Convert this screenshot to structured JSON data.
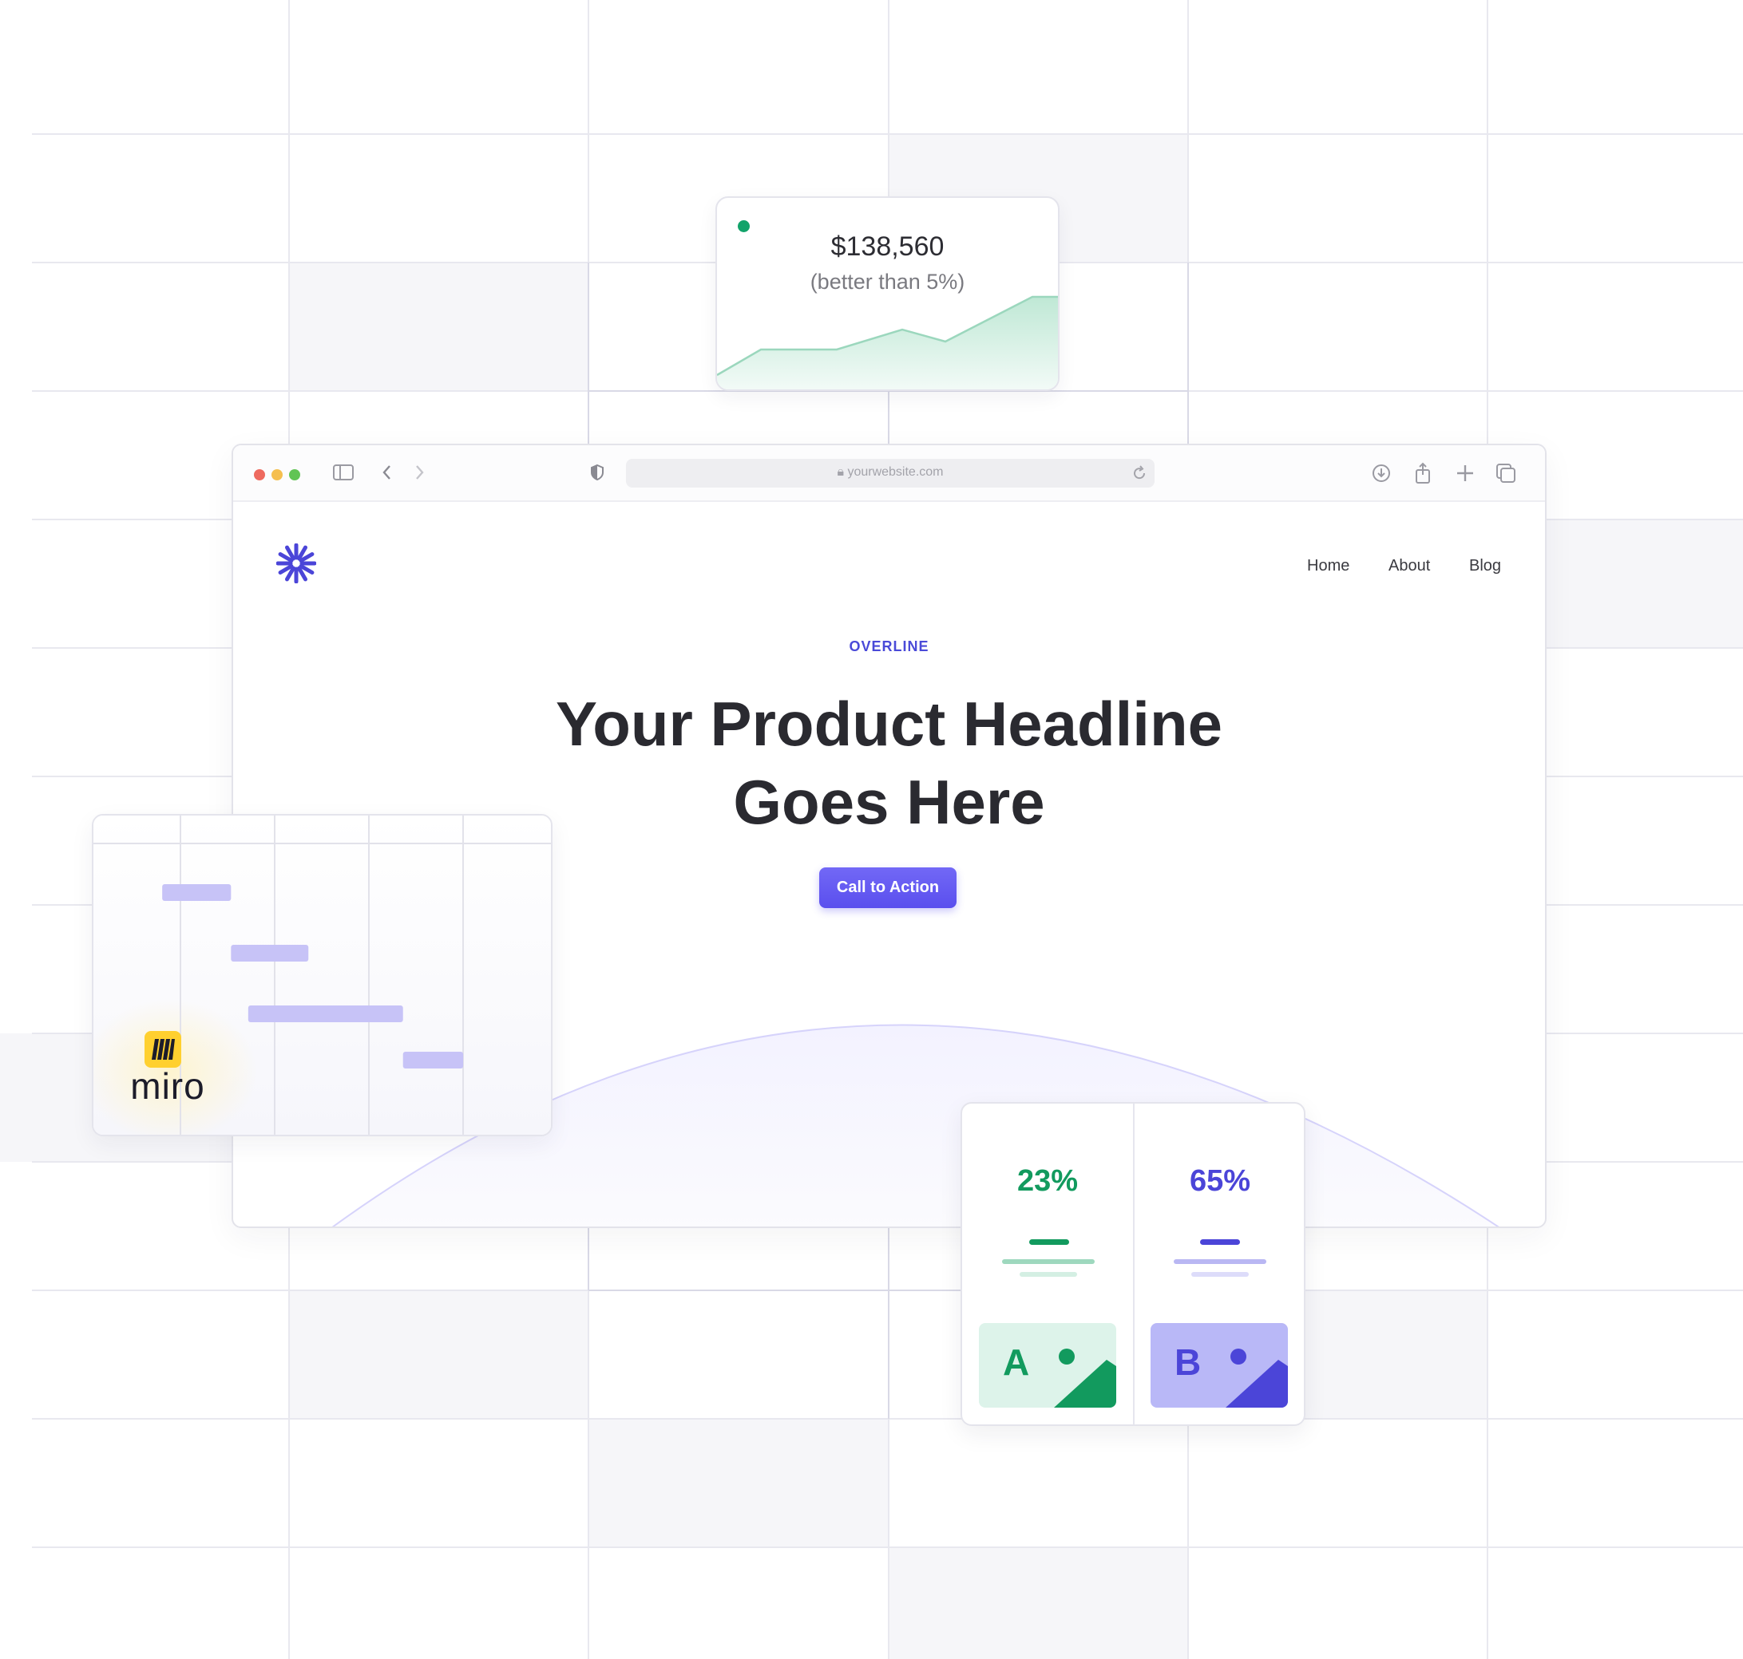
{
  "background": {
    "grid_color": "#e8e8ef",
    "shade_color": "#f6f6f9"
  },
  "revenue_card": {
    "amount": "$138,560",
    "note": "(better than 5%)",
    "status_color": "#12a36a",
    "accent_color": "#9bd7bd"
  },
  "browser": {
    "traffic_lights": [
      "#ee6a5f",
      "#f5bf4f",
      "#61c454"
    ],
    "url": "yourwebsite.com",
    "toolbar_icons": [
      "sidebar-icon",
      "back-icon",
      "forward-icon",
      "shield-icon",
      "reload-icon",
      "download-icon",
      "share-icon",
      "new-tab-icon",
      "tabs-icon"
    ],
    "nav": [
      "Home",
      "About",
      "Blog"
    ],
    "overline": "OVERLINE",
    "headline_line1": "Your Product Headline",
    "headline_line2": "Goes Here",
    "cta_label": "Call to Action",
    "brand_color": "#4b45d8"
  },
  "gantt_card": {
    "bar_color": "#c7c3f7",
    "tasks": [
      {
        "start": 0.8,
        "end": 1.6
      },
      {
        "start": 1.6,
        "end": 2.5
      },
      {
        "start": 1.8,
        "end": 3.6
      },
      {
        "start": 3.6,
        "end": 4.3
      }
    ],
    "logo_text": "miro",
    "logo_color": "#ffd02f"
  },
  "ab_card": {
    "variants": [
      {
        "label": "A",
        "percent": "23%",
        "color": "#129a5e",
        "tint": "#ddf3ea"
      },
      {
        "label": "B",
        "percent": "65%",
        "color": "#4b45d8",
        "tint": "#b9b8f7"
      }
    ]
  }
}
